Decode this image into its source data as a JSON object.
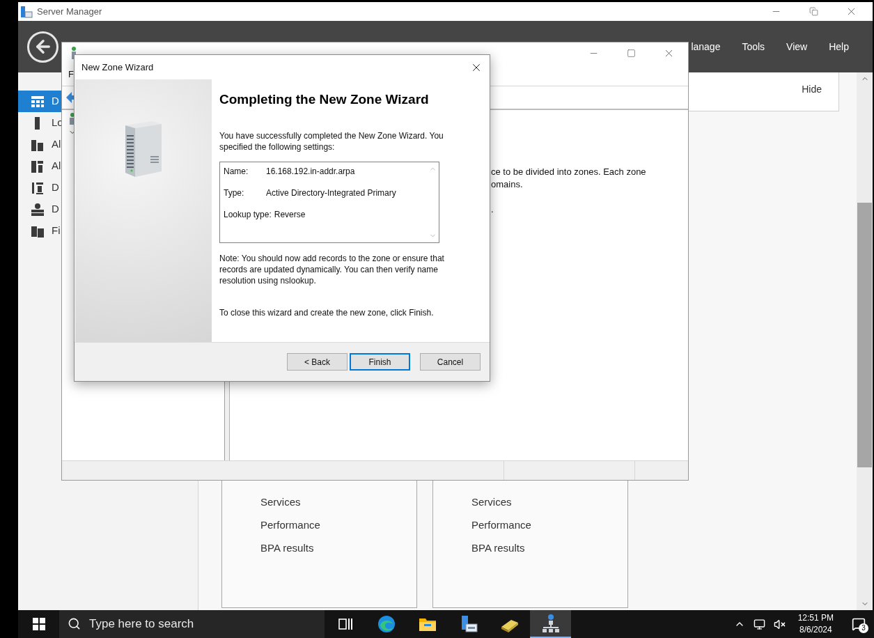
{
  "server_manager": {
    "title": "Server Manager",
    "menu": [
      "lanage",
      "Tools",
      "View",
      "Help"
    ],
    "sidebar": [
      {
        "kind": "dashboard",
        "label": "D",
        "selected": true
      },
      {
        "kind": "server",
        "label": "Lo",
        "selected": false
      },
      {
        "kind": "servers",
        "label": "Al",
        "selected": false
      },
      {
        "kind": "roles",
        "label": "Al",
        "selected": false
      },
      {
        "kind": "tools",
        "label": "D",
        "selected": false
      },
      {
        "kind": "storage",
        "label": "D",
        "selected": false
      },
      {
        "kind": "files",
        "label": "Fi",
        "selected": false
      }
    ],
    "hide_button": "Hide",
    "tiles": [
      {
        "links": [
          "Services",
          "Performance",
          "BPA results"
        ]
      },
      {
        "links": [
          "Services",
          "Performance",
          "BPA results"
        ]
      }
    ]
  },
  "dns_manager": {
    "menu": [
      "F"
    ],
    "content_lines": [
      "ce to be divided into zones. Each zone",
      "omains.",
      "."
    ]
  },
  "wizard": {
    "title": "New Zone Wizard",
    "heading": "Completing the New Zone Wizard",
    "intro": "You have successfully completed the New Zone Wizard. You specified the following settings:",
    "settings": [
      {
        "label": "Name:",
        "value": "16.168.192.in-addr.arpa"
      },
      {
        "label": "Type:",
        "value": "Active Directory-Integrated Primary"
      },
      {
        "label": "Lookup type:",
        "value": "Reverse"
      }
    ],
    "note": "Note: You should now add records to the zone or ensure that records are updated dynamically. You can then verify name resolution using nslookup.",
    "closing": "To close this wizard and create the new zone, click Finish.",
    "buttons": [
      {
        "label": "< Back",
        "default": false
      },
      {
        "label": "Finish",
        "default": true
      },
      {
        "label": "Cancel",
        "default": false
      }
    ]
  },
  "taskbar": {
    "search_placeholder": "Type here to search",
    "apps": [
      {
        "kind": "taskview",
        "active": false
      },
      {
        "kind": "edge",
        "active": false
      },
      {
        "kind": "explorer",
        "active": false
      },
      {
        "kind": "servermanager",
        "active": false
      },
      {
        "kind": "drive",
        "active": false
      },
      {
        "kind": "dns",
        "active": true
      }
    ],
    "time": "12:51 PM",
    "date": "8/6/2024",
    "notification_count": "3"
  }
}
